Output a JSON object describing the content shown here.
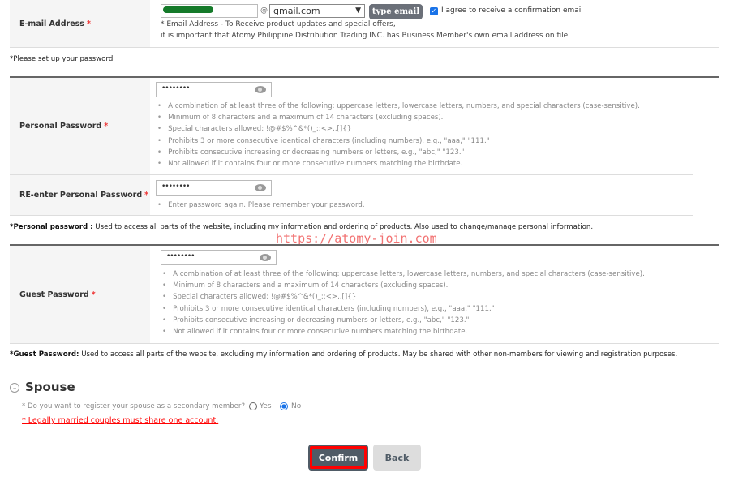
{
  "email": {
    "label": "E-mail Address",
    "username": "",
    "domain": "gmail.com",
    "type_button": "type email",
    "agree_label": "I agree to receive a confirmation email",
    "agree_checked": true,
    "note_1": "* Email Address - To Receive product updates and special offers,",
    "note_2": "it is important that Atomy Philippine Distribution Trading INC. has Business Member's own email address on file.",
    "at": "@"
  },
  "password_intro": "*Please set up your password",
  "required_mark": "*",
  "personal": {
    "label": "Personal Password",
    "value": "••••••••",
    "rules": [
      "A combination of at least three of the following: uppercase letters, lowercase letters, numbers, and special characters (case-sensitive).",
      "Minimum of 8 characters and a maximum of 14 characters (excluding spaces).",
      "Special characters allowed: !@#$%^&*()_;:<>,.[]{}",
      "Prohibits 3 or more consecutive identical characters (including numbers), e.g., \"aaa,\" \"111.\"",
      "Prohibits consecutive increasing or decreasing numbers or letters, e.g., \"abc,\" \"123.\"",
      "Not allowed if it contains four or more consecutive numbers matching the birthdate."
    ]
  },
  "reenter": {
    "label": "RE-enter Personal Password",
    "value": "••••••••",
    "rule": "Enter password again. Please remember your password."
  },
  "personal_note": {
    "title": "*Personal password :",
    "text": " Used to access all parts of the website, including my information and ordering of products. Also used to change/manage personal information."
  },
  "watermark": "https://atomy-join.com",
  "guest": {
    "label": "Guest Password",
    "value": "••••••••",
    "rules": [
      "A combination of at least three of the following: uppercase letters, lowercase letters, numbers, and special characters (case-sensitive).",
      "Minimum of 8 characters and a maximum of 14 characters (excluding spaces).",
      "Special characters allowed: !@#$%^&*()_;:<>,.[]{}",
      "Prohibits 3 or more consecutive identical characters (including numbers), e.g., \"aaa,\" \"111.\"",
      "Prohibits consecutive increasing or decreasing numbers or letters, e.g., \"abc,\" \"123.\"",
      "Not allowed if it contains four or more consecutive numbers matching the birthdate."
    ]
  },
  "guest_note": {
    "title": "*Guest Password:",
    "text": " Used to access all parts of the website, excluding my information and ordering of products. May be shared with other non-members for viewing and registration purposes."
  },
  "spouse": {
    "title": "Spouse",
    "question": "* Do you want to register your spouse as a secondary member?",
    "yes": "Yes",
    "no": "No",
    "selected": "No",
    "warning": "* Legally married couples must share one account."
  },
  "buttons": {
    "confirm": "Confirm",
    "back": "Back"
  },
  "colors": {
    "confirm_bg": "#4f5b66",
    "highlight": "#ff0000",
    "warning": "#ff0000",
    "back_bg": "#dddddd"
  }
}
